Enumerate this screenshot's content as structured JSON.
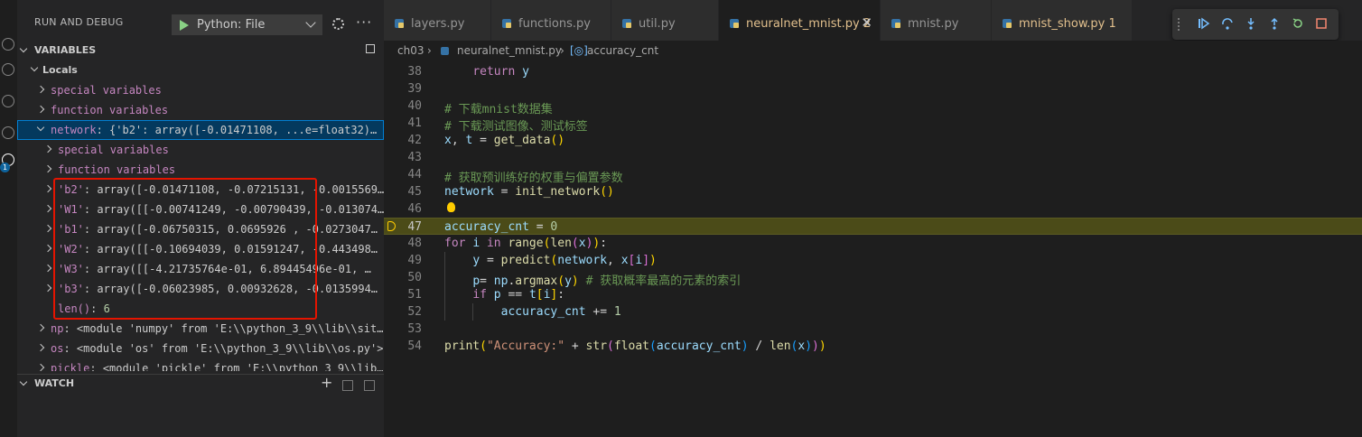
{
  "sidebar": {
    "title": "RUN AND DEBUG",
    "config_selected": "Python: File",
    "variables_header": "VARIABLES",
    "locals_label": "Locals",
    "watch_header": "WATCH",
    "rows": [
      {
        "key": "special variables",
        "sep": "",
        "value": ""
      },
      {
        "key": "function variables",
        "sep": "",
        "value": ""
      },
      {
        "key": "network",
        "sep": ": ",
        "value": "{'b2': array([-0.01471108, ...e=float32)…"
      },
      {
        "key": "special variables",
        "sep": "",
        "value": ""
      },
      {
        "key": "function variables",
        "sep": "",
        "value": ""
      },
      {
        "key": "'b2'",
        "sep": ": ",
        "value": "array([-0.01471108, -0.07215131, -0.0015569…"
      },
      {
        "key": "'W1'",
        "sep": ": ",
        "value": "array([[-0.00741249, -0.00790439, -0.013074…"
      },
      {
        "key": "'b1'",
        "sep": ": ",
        "value": "array([-0.06750315,  0.0695926 , -0.0273047…"
      },
      {
        "key": "'W2'",
        "sep": ": ",
        "value": "array([[-0.10694039,  0.01591247, -0.443498…"
      },
      {
        "key": "'W3'",
        "sep": ": ",
        "value": "array([[-4.21735764e-01,  6.89445496e-01,  …"
      },
      {
        "key": "'b3'",
        "sep": ": ",
        "value": "array([-0.06023985,  0.00932628, -0.0135994…"
      },
      {
        "key": "len()",
        "sep": ": ",
        "value": "6"
      },
      {
        "key": "np",
        "sep": ": ",
        "value": "<module 'numpy' from 'E:\\\\python_3_9\\\\lib\\\\sit…"
      },
      {
        "key": "os",
        "sep": ": ",
        "value": "<module 'os' from 'E:\\\\python_3_9\\\\lib\\\\os.py'>"
      },
      {
        "key": "pickle",
        "sep": ": ",
        "value": "<module 'pickle' from 'E:\\\\python_3_9\\\\lib…"
      }
    ]
  },
  "tabs": [
    {
      "label": "layers.py",
      "badge": ""
    },
    {
      "label": "functions.py",
      "badge": ""
    },
    {
      "label": "util.py",
      "badge": ""
    },
    {
      "label": "neuralnet_mnist.py",
      "badge": "2"
    },
    {
      "label": "mnist.py",
      "badge": ""
    },
    {
      "label": "mnist_show.py",
      "badge": "1"
    }
  ],
  "breadcrumb": {
    "folder": "ch03",
    "file": "neuralnet_mnist.py",
    "symbol": "accuracy_cnt"
  },
  "editor": {
    "current_line": "47",
    "lines": [
      {
        "n": "38",
        "text": "    return y"
      },
      {
        "n": "39",
        "text": ""
      },
      {
        "n": "40",
        "text": "# 下载mnist数据集"
      },
      {
        "n": "41",
        "text": "# 下载测试图像、测试标签"
      },
      {
        "n": "42",
        "text": "x, t = get_data()"
      },
      {
        "n": "43",
        "text": ""
      },
      {
        "n": "44",
        "text": "# 获取预训练好的权重与偏置参数"
      },
      {
        "n": "45",
        "text": "network = init_network()"
      },
      {
        "n": "46",
        "text": ""
      },
      {
        "n": "47",
        "text": "accuracy_cnt = 0"
      },
      {
        "n": "48",
        "text": "for i in range(len(x)):"
      },
      {
        "n": "49",
        "text": "    y = predict(network, x[i])"
      },
      {
        "n": "50",
        "text": "    p= np.argmax(y) # 获取概率最高的元素的索引"
      },
      {
        "n": "51",
        "text": "    if p == t[i]:"
      },
      {
        "n": "52",
        "text": "        accuracy_cnt += 1"
      },
      {
        "n": "53",
        "text": ""
      },
      {
        "n": "54",
        "text": "print(\"Accuracy:\" + str(float(accuracy_cnt) / len(x)))"
      }
    ]
  },
  "colors": {
    "accent": "#007fd4",
    "highlight_box": "#e51400",
    "current_line_bg": "#4b4b18"
  }
}
